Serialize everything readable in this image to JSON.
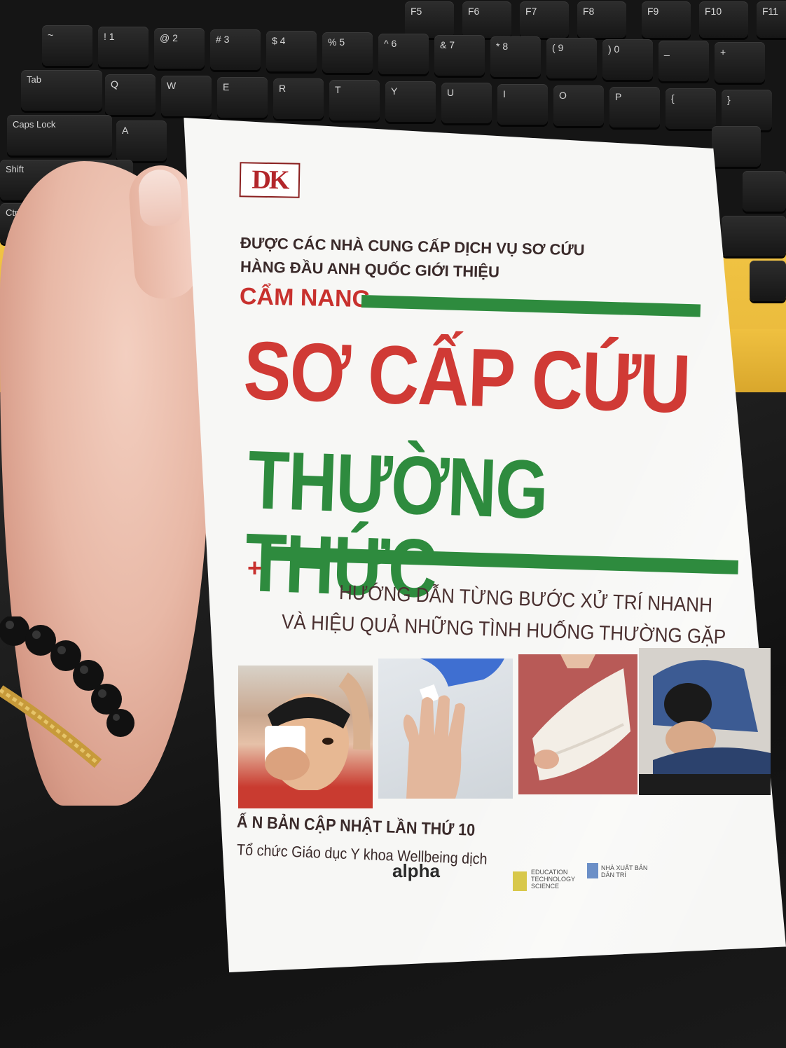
{
  "keyboard": {
    "function_row": [
      "F5",
      "F6",
      "F7",
      "F8",
      "F9",
      "F10",
      "F11"
    ],
    "number_row": [
      "~",
      "!",
      "@",
      "#",
      "$",
      "%",
      "^",
      "&",
      "*",
      "(",
      ")",
      "_",
      "+"
    ],
    "number_row_digits": [
      "1",
      "2",
      "3",
      "4",
      "5",
      "6",
      "7",
      "8",
      "9",
      "0"
    ],
    "top_row": [
      "Tab",
      "Q",
      "W",
      "E",
      "R",
      "T",
      "Y",
      "U",
      "I",
      "O",
      "P",
      "{",
      "}"
    ],
    "home_row": [
      "Caps Lock",
      "A"
    ],
    "shift_label": "Shift",
    "ctrl_label": "Ctrl"
  },
  "book": {
    "logo_text": "DK",
    "endorsement_line_1": "ĐƯỢC CÁC NHÀ CUNG CẤP DỊCH VỤ SƠ CỨU",
    "endorsement_line_2": "HÀNG ĐẦU ANH QUỐC GIỚI THIỆU",
    "series_label": "CẨM NANG",
    "title_line_1": "SƠ CẤP CỨU",
    "title_line_2": "THƯỜNG THỨC",
    "plus_symbol": "+",
    "subtitle_line_1": "HƯỚNG DẪN TỪNG BƯỚC XỬ TRÍ NHANH",
    "subtitle_line_2": "VÀ HIỆU QUẢ NHỮNG TÌNH HUỐNG THƯỜNG GẶP",
    "edition": "Ấ N BẢN CẬP NHẬT LẦN THỨ 10",
    "translator": "Tổ  chức Giáo dục Y khoa Wellbeing dịch",
    "publishers": {
      "alpha": "alpha",
      "edu_tech": "EDUCATION TECHNOLOGY SCIENCE",
      "nxb": "NHÀ XUẤT BẢN DÂN TRÍ"
    },
    "colors": {
      "title_red": "#d03a35",
      "title_green": "#2e8b3e",
      "cover": "#f7f7f5"
    }
  }
}
